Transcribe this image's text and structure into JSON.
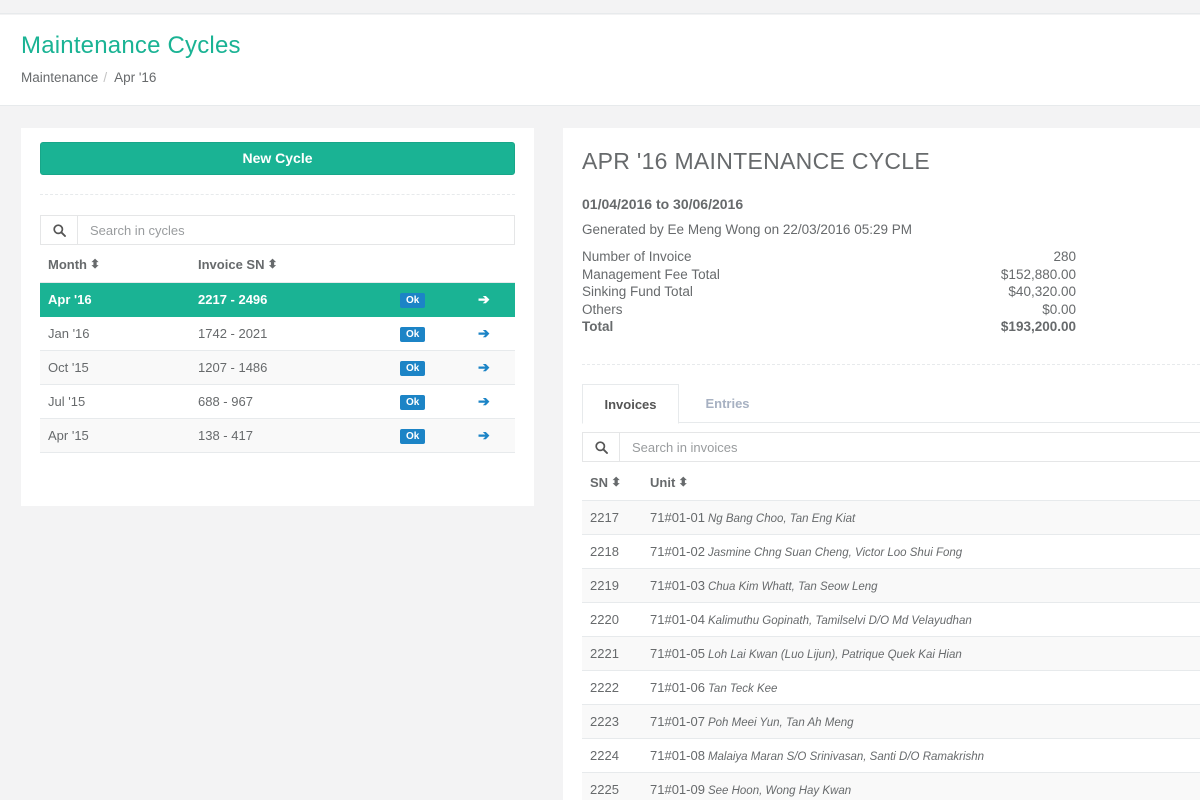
{
  "header": {
    "title": "Maintenance Cycles",
    "breadcrumb": [
      "Maintenance",
      "Apr '16"
    ]
  },
  "left": {
    "new_cycle_label": "New Cycle",
    "search_placeholder": "Search in cycles",
    "columns": {
      "month": "Month",
      "invoice_sn": "Invoice SN"
    },
    "cycles": [
      {
        "month": "Apr '16",
        "range": "2217 - 2496",
        "status": "Ok"
      },
      {
        "month": "Jan '16",
        "range": "1742 - 2021",
        "status": "Ok"
      },
      {
        "month": "Oct '15",
        "range": "1207 - 1486",
        "status": "Ok"
      },
      {
        "month": "Jul '15",
        "range": "688 - 967",
        "status": "Ok"
      },
      {
        "month": "Apr '15",
        "range": "138 - 417",
        "status": "Ok"
      }
    ],
    "selected_month": "Apr '16"
  },
  "detail": {
    "title": "APR '16 MAINTENANCE CYCLE",
    "period": "01/04/2016 to 30/06/2016",
    "generated": "Generated by Ee Meng Wong on 22/03/2016 05:29 PM",
    "summary": [
      {
        "label": "Number of Invoice",
        "value": "280"
      },
      {
        "label": "Management Fee Total",
        "value": "$152,880.00"
      },
      {
        "label": "Sinking Fund Total",
        "value": "$40,320.00"
      },
      {
        "label": "Others",
        "value": "$0.00"
      },
      {
        "label": "Total",
        "value": "$193,200.00"
      }
    ],
    "tabs": [
      "Invoices",
      "Entries"
    ],
    "active_tab": "Invoices",
    "search_placeholder": "Search in invoices",
    "columns": {
      "sn": "SN",
      "unit": "Unit"
    },
    "invoices": [
      {
        "sn": "2217",
        "unit": "71#01-01",
        "owners": "Ng Bang Choo, Tan Eng Kiat"
      },
      {
        "sn": "2218",
        "unit": "71#01-02",
        "owners": "Jasmine Chng Suan Cheng, Victor Loo Shui Fong"
      },
      {
        "sn": "2219",
        "unit": "71#01-03",
        "owners": "Chua Kim Whatt, Tan Seow Leng"
      },
      {
        "sn": "2220",
        "unit": "71#01-04",
        "owners": "Kalimuthu Gopinath, Tamilselvi D/O Md Velayudhan"
      },
      {
        "sn": "2221",
        "unit": "71#01-05",
        "owners": "Loh Lai Kwan (Luo Lijun), Patrique Quek Kai Hian"
      },
      {
        "sn": "2222",
        "unit": "71#01-06",
        "owners": "Tan Teck Kee"
      },
      {
        "sn": "2223",
        "unit": "71#01-07",
        "owners": "Poh Meei Yun, Tan Ah Meng"
      },
      {
        "sn": "2224",
        "unit": "71#01-08",
        "owners": "Malaiya Maran S/O Srinivasan, Santi D/O Ramakrishn"
      },
      {
        "sn": "2225",
        "unit": "71#01-09",
        "owners": "See Hoon, Wong Hay Kwan"
      }
    ]
  },
  "colors": {
    "accent": "#1ab394",
    "badge": "#1c84c6",
    "text": "#676a6c"
  },
  "icons": {
    "search": "search-icon",
    "sort": "sort-icon",
    "arrow": "arrow-right-icon"
  }
}
